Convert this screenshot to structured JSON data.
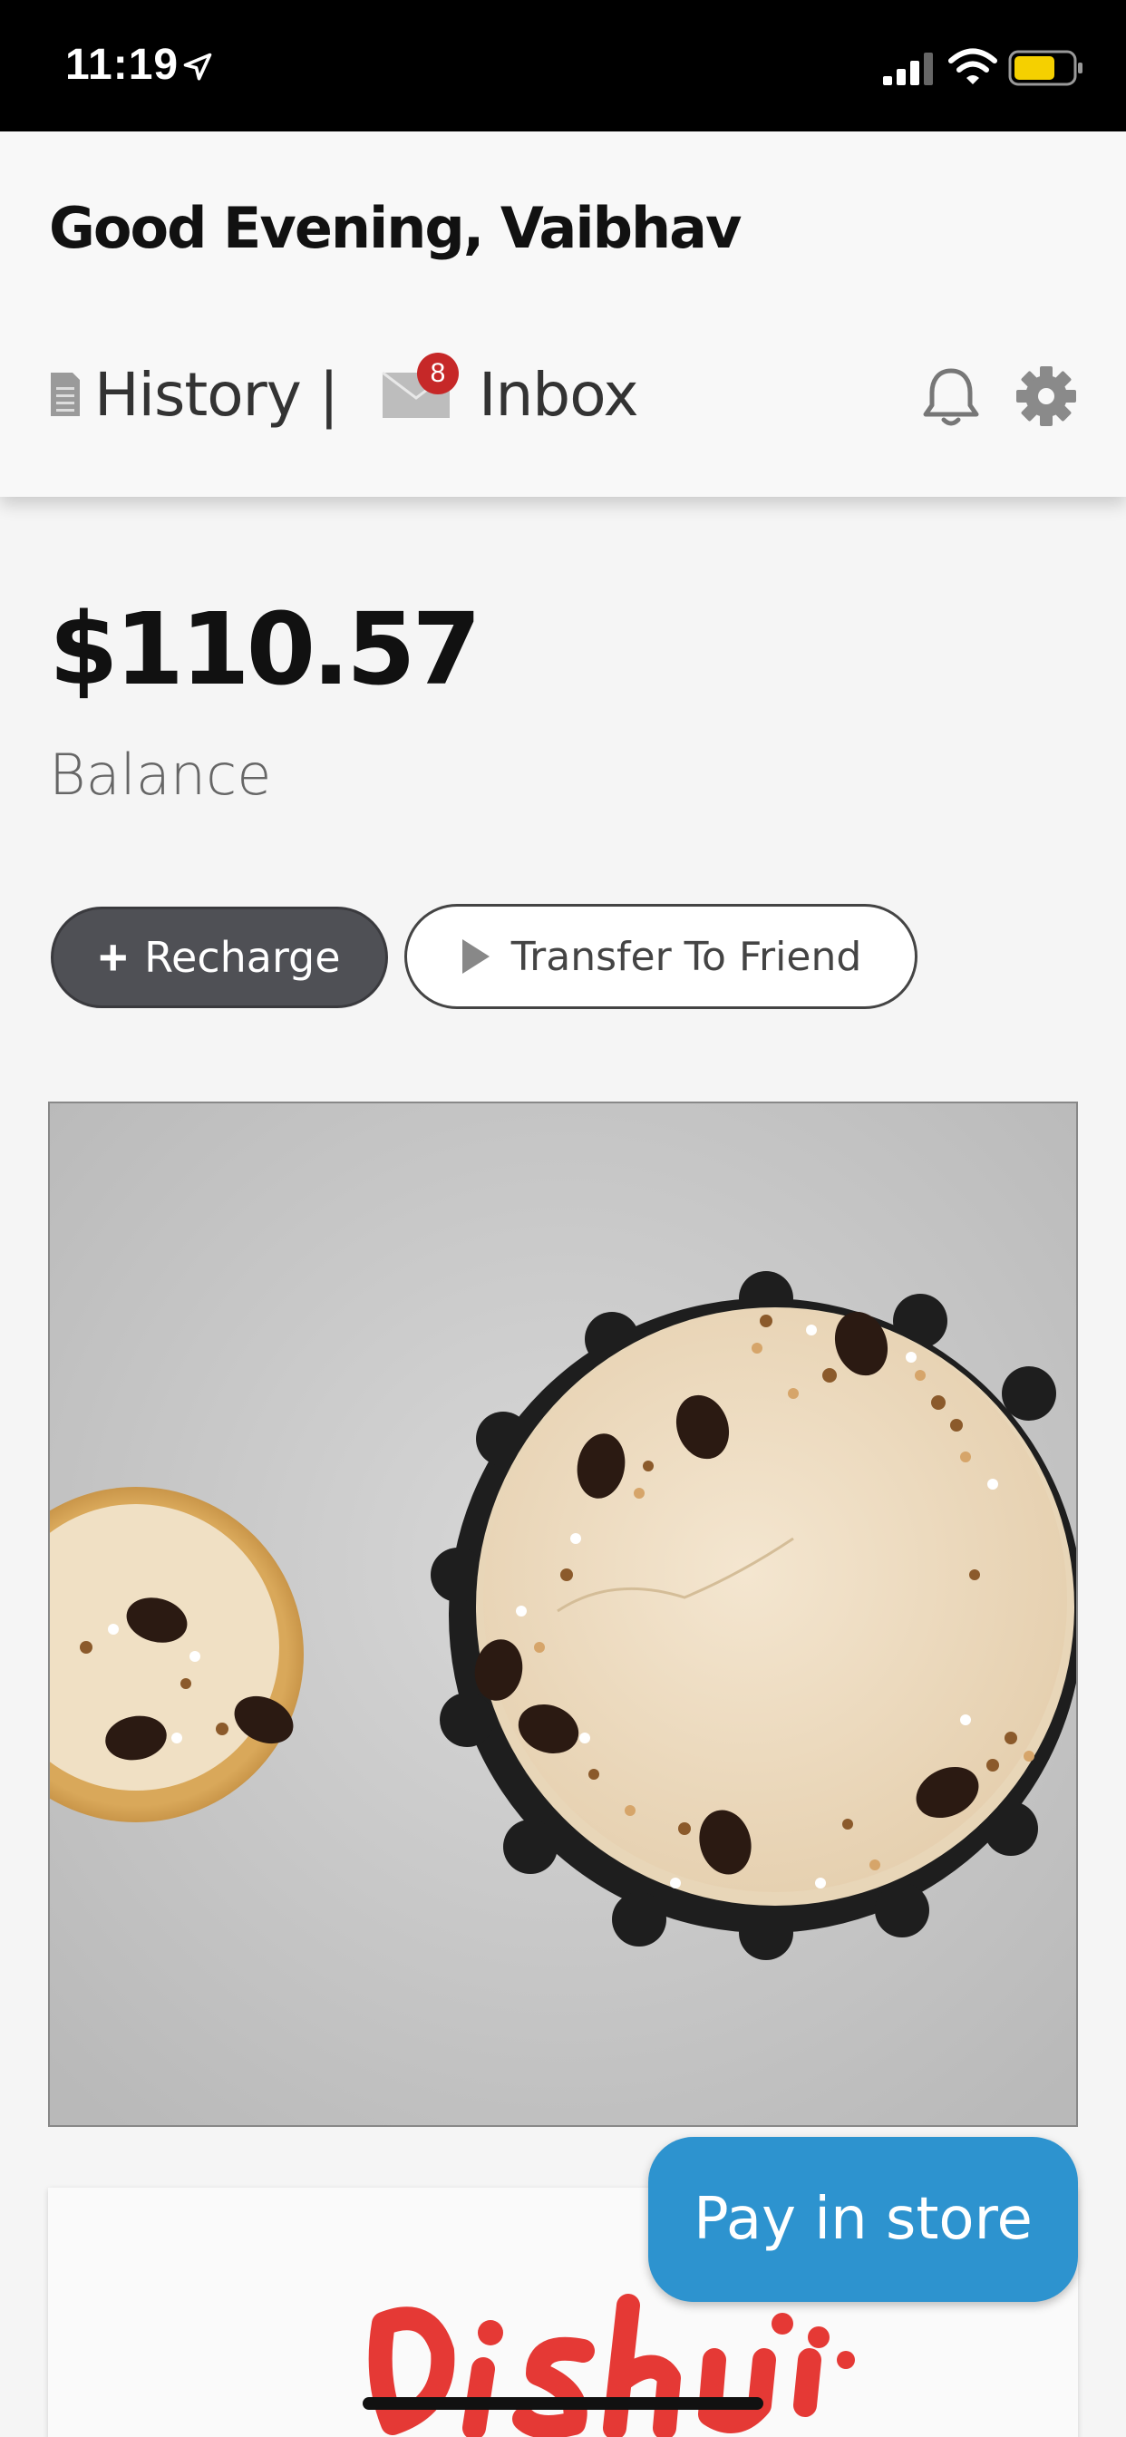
{
  "status_bar": {
    "time": "11:19"
  },
  "header": {
    "greeting": "Good Evening, Vaibhav",
    "history_label": "History |",
    "inbox_label": "Inbox",
    "inbox_badge": "8",
    "icons": [
      "document-icon",
      "mail-icon",
      "bell-icon",
      "gear-icon"
    ]
  },
  "balance": {
    "amount": "$110.57",
    "label": "Balance"
  },
  "actions": {
    "recharge_label": "Recharge",
    "transfer_label": "Transfer To Friend"
  },
  "promo": {
    "image": "coffee-cheesecake-photo"
  },
  "brand": {
    "logo": "dishu-logo",
    "color": "#e53935"
  },
  "pay_button": {
    "label": "Pay in store",
    "color": "#2d93cf"
  }
}
